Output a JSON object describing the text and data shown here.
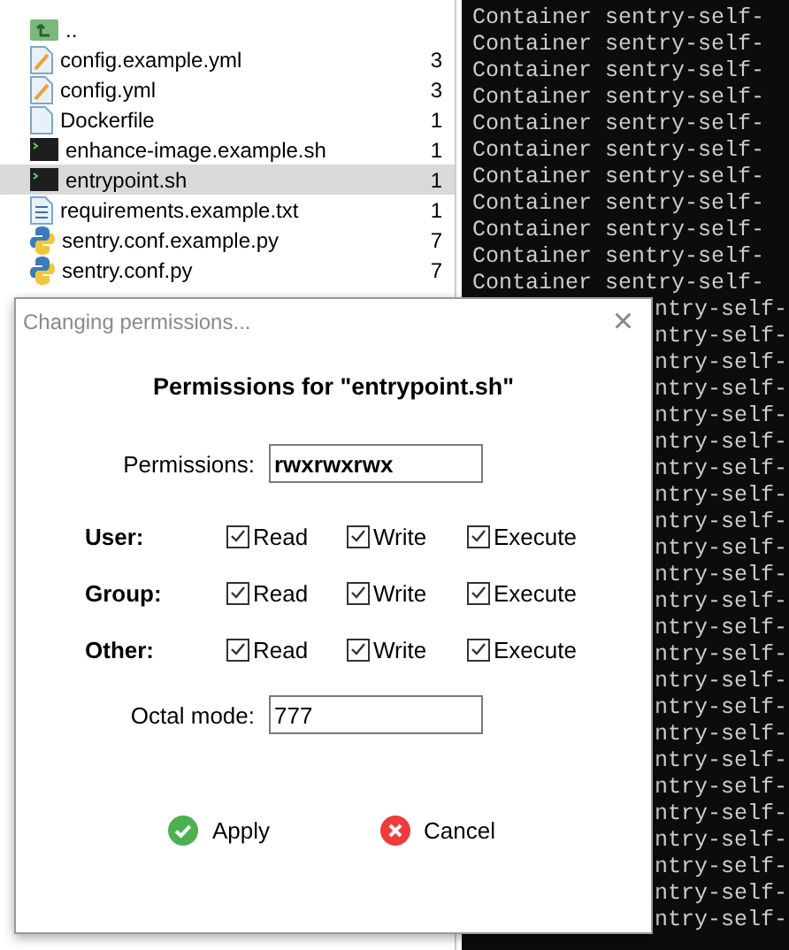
{
  "files": [
    {
      "name": "..",
      "kind": "parent",
      "selected": false
    },
    {
      "name": "config.example.yml",
      "count": "3",
      "kind": "edit",
      "selected": false
    },
    {
      "name": "config.yml",
      "count": "3",
      "kind": "edit",
      "selected": false
    },
    {
      "name": "Dockerfile",
      "count": "1",
      "kind": "file",
      "selected": false
    },
    {
      "name": "enhance-image.example.sh",
      "count": "1",
      "kind": "shell",
      "selected": false
    },
    {
      "name": "entrypoint.sh",
      "count": "1",
      "kind": "shell",
      "selected": true
    },
    {
      "name": "requirements.example.txt",
      "count": "1",
      "kind": "text",
      "selected": false
    },
    {
      "name": "sentry.conf.example.py",
      "count": "7",
      "kind": "python",
      "selected": false
    },
    {
      "name": "sentry.conf.py",
      "count": "7",
      "kind": "python",
      "selected": false
    }
  ],
  "terminal": {
    "lines": [
      {
        "text": "Container sentry-self-",
        "kind": "full"
      },
      {
        "text": "Container sentry-self-",
        "kind": "full"
      },
      {
        "text": "Container sentry-self-",
        "kind": "full"
      },
      {
        "text": "Container sentry-self-",
        "kind": "full"
      },
      {
        "text": "Container sentry-self-",
        "kind": "full"
      },
      {
        "text": "Container sentry-self-",
        "kind": "full"
      },
      {
        "text": "Container sentry-self-",
        "kind": "full"
      },
      {
        "text": "Container sentry-self-",
        "kind": "full"
      },
      {
        "text": "Container sentry-self-",
        "kind": "full"
      },
      {
        "text": "Container sentry-self-",
        "kind": "full"
      },
      {
        "text": "Container sentry-self-",
        "kind": "full"
      },
      {
        "text": "ntry-self-",
        "kind": "partial"
      },
      {
        "text": "ntry-self-",
        "kind": "partial"
      },
      {
        "text": "ntry-self-",
        "kind": "partial"
      },
      {
        "text": "ntry-self-",
        "kind": "partial"
      },
      {
        "text": "ntry-self-",
        "kind": "partial"
      },
      {
        "text": "ntry-self-",
        "kind": "partial"
      },
      {
        "text": "ntry-self-",
        "kind": "partial"
      },
      {
        "text": "ntry-self-",
        "kind": "partial"
      },
      {
        "text": "ntry-self-",
        "kind": "partial"
      },
      {
        "text": "ntry-self-",
        "kind": "partial"
      },
      {
        "text": "ntry-self-",
        "kind": "partial"
      },
      {
        "text": "ntry-self-",
        "kind": "partial"
      },
      {
        "text": "ntry-self-",
        "kind": "partial"
      },
      {
        "text": "ntry-self-",
        "kind": "partial"
      },
      {
        "text": "ntry-self-",
        "kind": "partial"
      },
      {
        "text": "ntry-self-",
        "kind": "partial"
      },
      {
        "text": "ntry-self-",
        "kind": "partial"
      },
      {
        "text": "ntry-self-",
        "kind": "partial"
      },
      {
        "text": "ntry-self-",
        "kind": "partial"
      },
      {
        "text": "ntry-self-",
        "kind": "partial"
      },
      {
        "text": "ntry-self-",
        "kind": "partial"
      },
      {
        "text": "ntry-self-",
        "kind": "partial"
      },
      {
        "text": "ntry-self-",
        "kind": "partial"
      },
      {
        "text": "ntry-self-",
        "kind": "partial"
      }
    ]
  },
  "dialog": {
    "title": "Changing permissions...",
    "close": "×",
    "heading": "Permissions for \"entrypoint.sh\"",
    "permissions_label": "Permissions:",
    "permissions_value": "rwxrwxrwx",
    "groups": [
      {
        "label": "User:",
        "options": [
          {
            "label": "Read",
            "checked": true
          },
          {
            "label": "Write",
            "checked": true
          },
          {
            "label": "Execute",
            "checked": true
          }
        ]
      },
      {
        "label": "Group:",
        "options": [
          {
            "label": "Read",
            "checked": true
          },
          {
            "label": "Write",
            "checked": true
          },
          {
            "label": "Execute",
            "checked": true
          }
        ]
      },
      {
        "label": "Other:",
        "options": [
          {
            "label": "Read",
            "checked": true
          },
          {
            "label": "Write",
            "checked": true
          },
          {
            "label": "Execute",
            "checked": true
          }
        ]
      }
    ],
    "octal_label": "Octal mode:",
    "octal_value": "777",
    "buttons": [
      {
        "label": "Apply",
        "kind": "apply"
      },
      {
        "label": "Cancel",
        "kind": "cancel"
      }
    ]
  }
}
